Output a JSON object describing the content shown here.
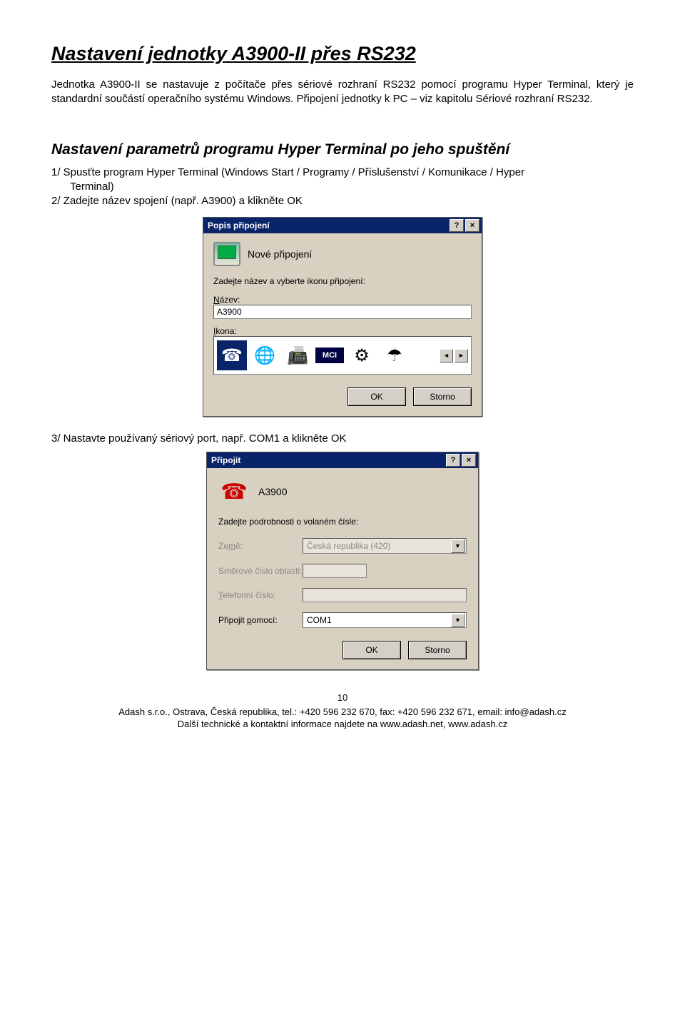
{
  "title": "Nastavení jednotky A3900-II přes RS232",
  "intro": "Jednotka A3900-II se nastavuje z počítače přes sériové rozhraní RS232 pomocí programu Hyper Terminal, který je standardní součástí operačního systému Windows. Připojení jednotky k PC – viz kapitolu Sériové rozhraní RS232.",
  "subheading": "Nastavení parametrů programu Hyper Terminal po jeho spuštění",
  "step1_a": "1/  Spusťte program Hyper Terminal (Windows Start / Programy / Příslušenství / Komunikace / Hyper",
  "step1_b": "Terminal)",
  "step2": "2/  Zadejte název spojení (např. A3900) a klikněte OK",
  "dialog1": {
    "title": "Popis připojení",
    "new_conn": "Nové připojení",
    "prompt": "Zadejte název a vyberte ikonu připojení:",
    "name_label": "Název:",
    "name_value": "A3900",
    "icon_label": "Ikona:",
    "ok": "OK",
    "cancel": "Storno"
  },
  "step3": "3/  Nastavte používaný sériový port, např. COM1 a klikněte OK",
  "dialog2": {
    "title": "Připojit",
    "conn_name": "A3900",
    "prompt": "Zadejte podrobnosti o volaném čísle:",
    "country_label": "Země:",
    "country_value": "Česká republika (420)",
    "area_label": "Směrové číslo oblasti:",
    "area_value": "",
    "phone_label": "Telefonní číslo:",
    "phone_value": "",
    "connect_label": "Připojit pomocí:",
    "connect_value": "COM1",
    "ok": "OK",
    "cancel": "Storno"
  },
  "footer": {
    "page": "10",
    "line1": "Adash s.r.o., Ostrava, Česká republika, tel.: +420 596 232 670, fax: +420 596 232 671, email: info@adash.cz",
    "line2_a": "Další technické a kontaktní informace najdete na ",
    "line2_b": "www.adash.net, www.adash.cz"
  }
}
